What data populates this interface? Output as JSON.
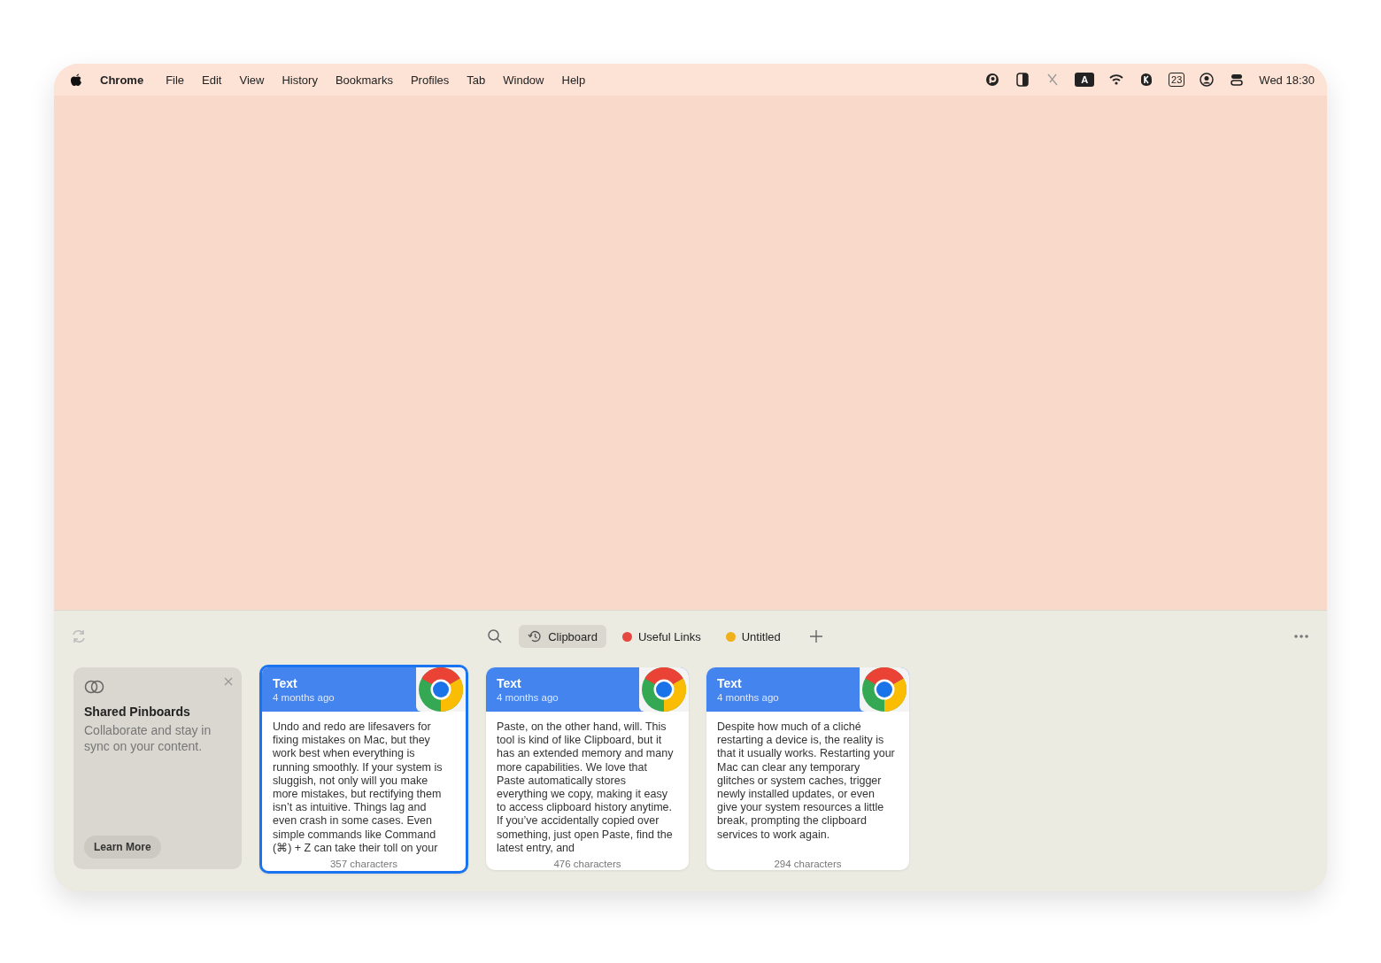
{
  "menu_bar": {
    "app": "Chrome",
    "items": [
      "File",
      "Edit",
      "View",
      "History",
      "Bookmarks",
      "Profiles",
      "Tab",
      "Window",
      "Help"
    ],
    "input_badge": "A",
    "calendar_day": "23",
    "clock": "Wed 18:30"
  },
  "pinboards": [
    {
      "label": "Clipboard",
      "kind": "history",
      "selected": true
    },
    {
      "label": "Useful Links",
      "kind": "dot",
      "color": "#e5483f",
      "selected": false
    },
    {
      "label": "Untitled",
      "kind": "dot",
      "color": "#f0b01c",
      "selected": false
    }
  ],
  "promo": {
    "title": "Shared Pinboards",
    "text": "Collaborate and stay in sync on your content.",
    "button": "Learn More"
  },
  "clips": [
    {
      "type": "Text",
      "time": "4 months ago",
      "body": "Undo and redo are lifesavers for fixing mistakes on Mac, but they work best when everything is running smoothly. If your system is sluggish, not only will you make more mistakes, but rectifying them isn’t as intuitive. Things lag and even crash in some cases. Even simple commands like Command (⌘) + Z can take their toll on your",
      "count": "357 characters",
      "selected": true
    },
    {
      "type": "Text",
      "time": "4 months ago",
      "body": "Paste, on the other hand, will. This tool is kind of like Clipboard, but it has an extended memory and many more capabilities. We love that Paste automatically stores everything we copy, making it easy to access clipboard history anytime. If you’ve accidentally copied over something, just open Paste, find the latest entry, and",
      "count": "476 characters",
      "selected": false
    },
    {
      "type": "Text",
      "time": "4 months ago",
      "body": "Despite how much of a cliché restarting a device is, the reality is that it usually works. Restarting your Mac can clear any temporary glitches or system caches, trigger newly installed updates, or even give your system resources a little break, prompting the clipboard services to work again.",
      "count": "294 characters",
      "selected": false
    }
  ]
}
